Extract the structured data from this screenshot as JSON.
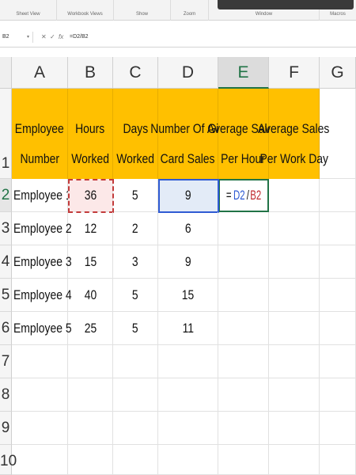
{
  "ribbon": {
    "groups": [
      "Sheet View",
      "Workbook Views",
      "Show",
      "Zoom",
      "Window",
      "Macros"
    ]
  },
  "formula_bar": {
    "name_box": "B2",
    "cancel_icon": "✕",
    "enter_icon": "✓",
    "fx_label": "fx",
    "formula": "=D2/B2"
  },
  "columns": [
    "A",
    "B",
    "C",
    "D",
    "E",
    "F",
    "G"
  ],
  "rows": [
    "1",
    "2",
    "3",
    "4",
    "5",
    "6",
    "7",
    "8",
    "9",
    "10"
  ],
  "headers": {
    "a": [
      "Employee",
      "Number"
    ],
    "b": [
      "Hours",
      "Worked"
    ],
    "c": [
      "Days",
      "Worked"
    ],
    "d": [
      "Number Of Gift",
      "Card Sales"
    ],
    "e": [
      "Average Sales",
      "Per Hour"
    ],
    "f": [
      "Average Sales",
      "Per Work Day"
    ]
  },
  "data_rows": [
    {
      "employee": "Employee 1",
      "hours": "36",
      "days": "5",
      "sales": "9"
    },
    {
      "employee": "Employee 2",
      "hours": "12",
      "days": "2",
      "sales": "6"
    },
    {
      "employee": "Employee 3",
      "hours": "15",
      "days": "3",
      "sales": "9"
    },
    {
      "employee": "Employee 4",
      "hours": "40",
      "days": "5",
      "sales": "15"
    },
    {
      "employee": "Employee 5",
      "hours": "25",
      "days": "5",
      "sales": "11"
    }
  ],
  "edit_cell": {
    "eq": "=",
    "ref1": "D2",
    "slash": "/",
    "ref2": "B2"
  },
  "colors": {
    "header_fill": "#ffc000",
    "selection_green": "#217346",
    "ref_blue": "#2f5bd3",
    "ref_red": "#c0282d"
  }
}
